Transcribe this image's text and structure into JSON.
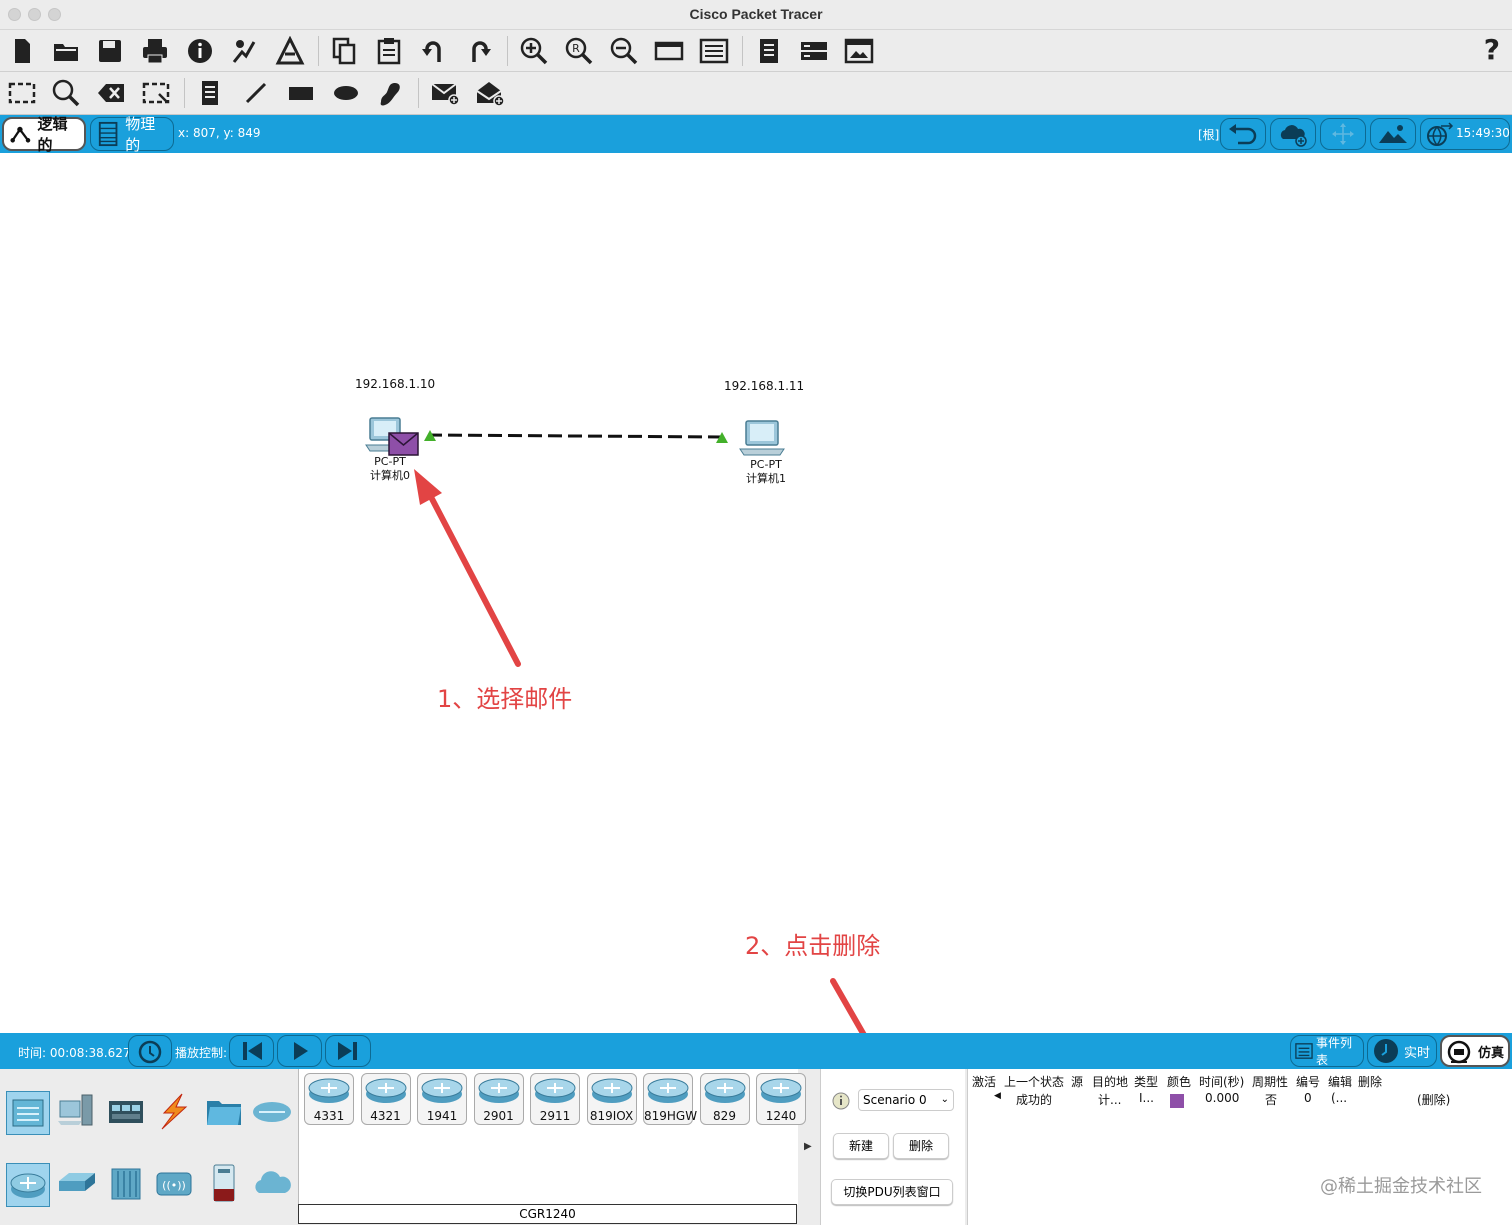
{
  "window": {
    "title": "Cisco Packet Tracer"
  },
  "mode_bar": {
    "logical_tab": "逻辑的",
    "physical_tab": "物理的",
    "coords": "x: 807, y: 849",
    "root_label": "[根]",
    "clock": "15:49:30"
  },
  "topology": {
    "pc0": {
      "ip": "192.168.1.10",
      "type": "PC-PT",
      "name": "计算机0"
    },
    "pc1": {
      "ip": "192.168.1.11",
      "type": "PC-PT",
      "name": "计算机1"
    }
  },
  "annotations": {
    "step1": "1、选择邮件",
    "step2": "2、点击删除"
  },
  "sim_bar": {
    "time_label": "时间: 00:08:38.627",
    "playback_label": "播放控制:",
    "event_list": "事件列表",
    "realtime": "实时",
    "simulation": "仿真"
  },
  "device_models": [
    "4331",
    "4321",
    "1941",
    "2901",
    "2911",
    "819IOX",
    "819HGW",
    "829",
    "1240"
  ],
  "selected_device_name": "CGR1240",
  "scenario": {
    "selected": "Scenario 0",
    "new_button": "新建",
    "delete_button": "删除",
    "toggle_pdu": "切换PDU列表窗口"
  },
  "pdu_table": {
    "headers": [
      "激活",
      "上一个状态",
      "源",
      "目的地",
      "类型",
      "颜色",
      "时间(秒)",
      "周期性",
      "编号",
      "编辑",
      "删除"
    ],
    "row": {
      "status": "成功的",
      "source": "计...",
      "destination": "I...",
      "color": "#8e4fa8",
      "time": "0.000",
      "periodic": "否",
      "num": "0",
      "edit": "(...",
      "delete": "(删除)"
    }
  },
  "watermark": "@稀土掘金技术社区",
  "colors": {
    "accent": "#1aa0dc",
    "annotation": "#e24444"
  }
}
